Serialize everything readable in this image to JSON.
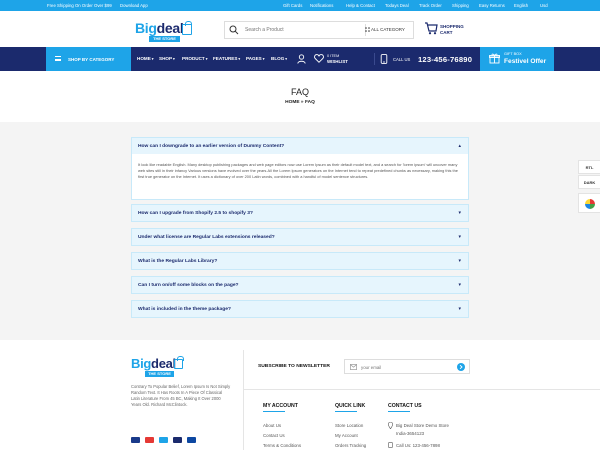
{
  "topbar": {
    "shipping": "Free Shipping On Order Over $99",
    "download": "Download App",
    "links": [
      "Gift Cards",
      "Notifications",
      "Help & Contact",
      "Todays Deal",
      "Track Order",
      "Shipping",
      "Easy Returns",
      "English",
      "Usd"
    ]
  },
  "logo": {
    "big": "Big",
    "deal": "deal",
    "sub": "THE STORE"
  },
  "search": {
    "placeholder": "Search a Product",
    "category": "ALL CATEGORY"
  },
  "cart": {
    "line1": "SHOPPING",
    "line2": "CART"
  },
  "nav": {
    "shop_by_category": "SHOP BY CATEGORY",
    "items": [
      "HOME",
      "SHOP",
      "PRODUCT",
      "FEATURES",
      "PAGES",
      "BLOG"
    ],
    "wishlist_count": "0 ITEM",
    "wishlist_label": "WISHLIST",
    "call_us": "CALL US",
    "phone": "123-456-76890",
    "gift_line1": "GIFT BOX",
    "gift_line2": "Festivel Offer"
  },
  "page": {
    "title": "FAQ",
    "crumb_home": "HOME",
    "crumb_sep": "»",
    "crumb_current": "FAQ"
  },
  "faq": {
    "open_question": "How can I downgrade to an earlier version of Dummy Content?",
    "answer": "It look like readable English. Many desktop publishing packages and web page editors now use Lorem Ipsum as their default model text, and a search for 'lorem ipsum' will uncover many web sites still in their infancy Various versions have evolved over the years.All the Lorem Ipsum generators on the Internet tend to repeat predefined chunks as necessary, making this the first true generator on the Internet. It uses a dictionary of over 200 Latin words, combined with a handful of model sentence structures.",
    "questions": [
      "How can I upgrade from Shopify 2.5 to shopify 3?",
      "Under what license are Regular Labs extensions released?",
      "What is the Regular Labs Library?",
      "Can I turn on/off some blocks on the page?",
      "What is included in the theme package?"
    ]
  },
  "sticky": {
    "rtl": "RTL",
    "dark": "DARK"
  },
  "footer": {
    "about": "Contrary To Popular Belief, Lorem Ipsum Is Not Simply Random Text. It Has Roots In A Piece Of Classical Latin Literature From 45 BC, Making It Over 2000 Years Old. Richard McClintock.",
    "newsletter": "SUBSCRIBE TO NEWSLETTER",
    "email_placeholder": "your email",
    "my_account": {
      "title": "MY ACCOUNT",
      "links": [
        "About Us",
        "Contact Us",
        "Terms & Conditions"
      ]
    },
    "quick_link": {
      "title": "QUICK LINK",
      "links": [
        "Store Location",
        "My Account",
        "Orders Tracking"
      ]
    },
    "contact": {
      "title": "CONTACT US",
      "address1": "Big Deal Store Demo Store",
      "address2": "India-3654123",
      "call": "Call Us: 123-456-7898"
    }
  },
  "colors": {
    "accent": "#1ea4e8",
    "navy": "#1b2a6d",
    "faq_bg": "#e6f5fd"
  }
}
